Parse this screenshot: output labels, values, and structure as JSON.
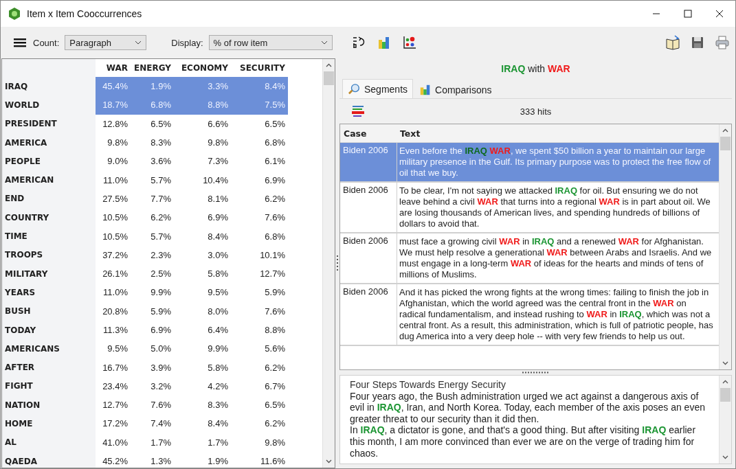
{
  "window": {
    "title": "Item x Item Cooccurrences"
  },
  "toolbar": {
    "count_label": "Count:",
    "count_value": "Paragraph",
    "display_label": "Display:",
    "display_value": "% of row item"
  },
  "matrix": {
    "columns": [
      "WAR",
      "ENERGY",
      "ECONOMY",
      "SECURITY"
    ],
    "rows": [
      {
        "item": "IRAQ",
        "values": [
          "45.4%",
          "1.9%",
          "3.3%",
          "8.4%"
        ],
        "selected": true
      },
      {
        "item": "WORLD",
        "values": [
          "18.7%",
          "6.8%",
          "8.8%",
          "7.5%"
        ],
        "selected": true
      },
      {
        "item": "PRESIDENT",
        "values": [
          "12.8%",
          "6.5%",
          "6.6%",
          "6.5%"
        ],
        "selected": false
      },
      {
        "item": "AMERICA",
        "values": [
          "9.8%",
          "8.3%",
          "9.8%",
          "6.8%"
        ],
        "selected": false
      },
      {
        "item": "PEOPLE",
        "values": [
          "9.0%",
          "3.6%",
          "7.3%",
          "6.1%"
        ],
        "selected": false
      },
      {
        "item": "AMERICAN",
        "values": [
          "11.0%",
          "5.7%",
          "10.4%",
          "6.9%"
        ],
        "selected": false
      },
      {
        "item": "END",
        "values": [
          "27.5%",
          "7.7%",
          "8.1%",
          "6.2%"
        ],
        "selected": false
      },
      {
        "item": "COUNTRY",
        "values": [
          "10.5%",
          "6.2%",
          "6.9%",
          "7.6%"
        ],
        "selected": false
      },
      {
        "item": "TIME",
        "values": [
          "10.5%",
          "5.7%",
          "8.4%",
          "6.8%"
        ],
        "selected": false
      },
      {
        "item": "TROOPS",
        "values": [
          "37.2%",
          "2.3%",
          "3.0%",
          "10.1%"
        ],
        "selected": false
      },
      {
        "item": "MILITARY",
        "values": [
          "26.1%",
          "2.5%",
          "5.8%",
          "12.7%"
        ],
        "selected": false
      },
      {
        "item": "YEARS",
        "values": [
          "11.0%",
          "9.9%",
          "9.5%",
          "5.9%"
        ],
        "selected": false
      },
      {
        "item": "BUSH",
        "values": [
          "20.8%",
          "5.9%",
          "8.0%",
          "7.6%"
        ],
        "selected": false
      },
      {
        "item": "TODAY",
        "values": [
          "11.3%",
          "6.9%",
          "6.4%",
          "8.8%"
        ],
        "selected": false
      },
      {
        "item": "AMERICANS",
        "values": [
          "9.5%",
          "5.0%",
          "9.9%",
          "5.6%"
        ],
        "selected": false
      },
      {
        "item": "AFTER",
        "values": [
          "16.7%",
          "3.9%",
          "5.8%",
          "6.2%"
        ],
        "selected": false
      },
      {
        "item": "FIGHT",
        "values": [
          "23.4%",
          "3.2%",
          "4.2%",
          "6.7%"
        ],
        "selected": false
      },
      {
        "item": "NATION",
        "values": [
          "12.7%",
          "7.6%",
          "8.3%",
          "6.5%"
        ],
        "selected": false
      },
      {
        "item": "HOME",
        "values": [
          "17.2%",
          "7.4%",
          "8.4%",
          "6.2%"
        ],
        "selected": false
      },
      {
        "item": "AL",
        "values": [
          "41.0%",
          "1.7%",
          "1.7%",
          "9.8%"
        ],
        "selected": false
      },
      {
        "item": "QAEDA",
        "values": [
          "45.2%",
          "1.3%",
          "1.9%",
          "11.6%"
        ],
        "selected": false
      }
    ]
  },
  "detail": {
    "heading": [
      {
        "text": "IRAQ",
        "kind": "row_item"
      },
      {
        "text": " with ",
        "kind": "plain"
      },
      {
        "text": "WAR",
        "kind": "column_item"
      }
    ],
    "tabs": [
      {
        "label": "Segments",
        "selected": true
      },
      {
        "label": "Comparisons",
        "selected": false
      }
    ],
    "hits": "333 hits",
    "segments": {
      "columns": [
        "Case",
        "Text"
      ],
      "rows": [
        {
          "case": "Biden 2006",
          "selected": true,
          "text": [
            {
              "text": "Even before the ",
              "kind": "plain"
            },
            {
              "text": "IRAQ ",
              "kind": "row_item"
            },
            {
              "text": "WAR",
              "kind": "column_item"
            },
            {
              "text": ", we spent $50 billion a year to maintain our large military presence in the Gulf. Its primary purpose was to protect the free flow of oil that we buy.",
              "kind": "plain"
            }
          ]
        },
        {
          "case": "Biden 2006",
          "selected": false,
          "text": [
            {
              "text": "To be clear, I'm not saying we attacked ",
              "kind": "plain"
            },
            {
              "text": "IRAQ",
              "kind": "row_item"
            },
            {
              "text": " for oil. But ensuring we do not leave behind a civil ",
              "kind": "plain"
            },
            {
              "text": "WAR",
              "kind": "column_item"
            },
            {
              "text": " that turns into a regional ",
              "kind": "plain"
            },
            {
              "text": "WAR",
              "kind": "column_item"
            },
            {
              "text": " is in part about oil. We are losing thousands of American lives, and spending hundreds of billions of dollars to avoid that.",
              "kind": "plain"
            }
          ]
        },
        {
          "case": "Biden 2006",
          "selected": false,
          "text": [
            {
              "text": "must face a growing civil ",
              "kind": "plain"
            },
            {
              "text": "WAR",
              "kind": "column_item"
            },
            {
              "text": " in ",
              "kind": "plain"
            },
            {
              "text": "IRAQ",
              "kind": "row_item"
            },
            {
              "text": " and a renewed ",
              "kind": "plain"
            },
            {
              "text": "WAR",
              "kind": "column_item"
            },
            {
              "text": " for Afghanistan. We must help resolve a generational ",
              "kind": "plain"
            },
            {
              "text": "WAR",
              "kind": "column_item"
            },
            {
              "text": " between Arabs and Israelis. And we must engage in a long-term ",
              "kind": "plain"
            },
            {
              "text": "WAR",
              "kind": "column_item"
            },
            {
              "text": " of ideas for the hearts and minds of tens of millions of Muslims.",
              "kind": "plain"
            }
          ]
        },
        {
          "case": "Biden 2006",
          "selected": false,
          "text": [
            {
              "text": "And it has picked the wrong fights at the wrong times: failing to finish the job in Afghanistan, which the world agreed was the central front in the ",
              "kind": "plain"
            },
            {
              "text": "WAR",
              "kind": "column_item"
            },
            {
              "text": " on radical fundamentalism, and instead rushing to ",
              "kind": "plain"
            },
            {
              "text": "WAR",
              "kind": "column_item"
            },
            {
              "text": " in ",
              "kind": "plain"
            },
            {
              "text": "IRAQ",
              "kind": "row_item"
            },
            {
              "text": ", which was not a central front. As a result, this administration, which is full of patriotic people, has dug America into a very deep hole -- with very few friends to help us out.",
              "kind": "plain"
            }
          ]
        }
      ]
    },
    "document": {
      "title": "Four Steps Towards Energy Security",
      "paragraphs": [
        [
          {
            "text": "Four years ago, the Bush administration urged we act against a dangerous axis of evil in ",
            "kind": "plain"
          },
          {
            "text": "IRAQ",
            "kind": "row_item"
          },
          {
            "text": ", Iran, and North Korea. Today, each member of the axis poses an even greater threat to our security than it did then.",
            "kind": "plain"
          }
        ],
        [
          {
            "text": "In ",
            "kind": "plain"
          },
          {
            "text": "IRAQ",
            "kind": "row_item"
          },
          {
            "text": ", a dictator is gone, and that's a good thing. But after visiting ",
            "kind": "plain"
          },
          {
            "text": "IRAQ",
            "kind": "row_item"
          },
          {
            "text": " earlier this month, I am more convinced than ever we are on the verge of trading him for chaos.",
            "kind": "plain"
          }
        ]
      ]
    }
  }
}
